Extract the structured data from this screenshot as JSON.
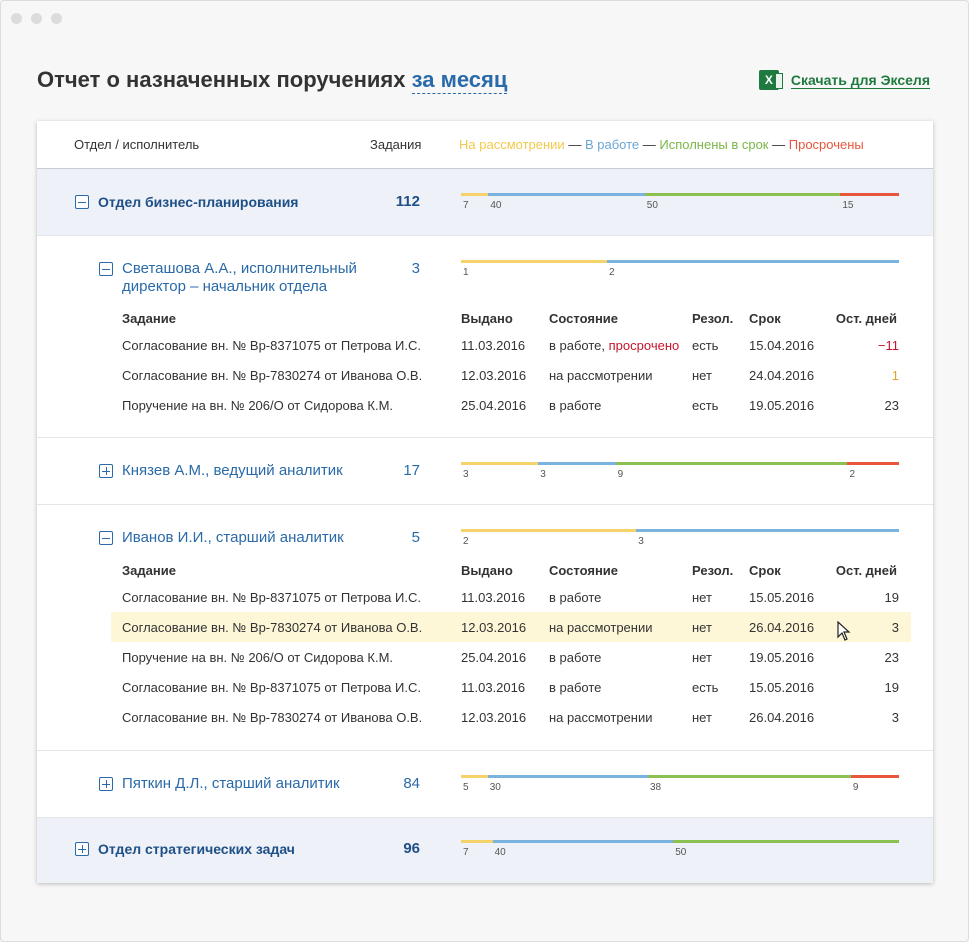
{
  "title": "Отчет о назначенных поручениях",
  "period": "за месяц",
  "download_label": "Скачать для Экселя",
  "columns": {
    "dept": "Отдел / исполнитель",
    "tasks": "Задания"
  },
  "legend": [
    {
      "label": "На рассмотрении",
      "color": "#f5d36a"
    },
    {
      "label": "В работе",
      "color": "#7ab3dd"
    },
    {
      "label": "Исполнены в срок",
      "color": "#8cc152"
    },
    {
      "label": "Просрочены",
      "color": "#e8573c"
    }
  ],
  "legend_sep": "—",
  "task_headers": [
    "Задание",
    "Выдано",
    "Состояние",
    "Резол.",
    "Срок",
    "Ост. дней"
  ],
  "departments": [
    {
      "name": "Отдел бизнес-планирования",
      "count": "112",
      "bar": [
        7,
        40,
        50,
        15
      ]
    },
    {
      "name": "Отдел стратегических задач",
      "count": "96",
      "bar": [
        7,
        40,
        50
      ]
    }
  ],
  "people": [
    {
      "name": "Светашова А.А., исполнительный директор – начальник отдела",
      "count": "3",
      "bar": [
        1,
        2
      ],
      "tasks": [
        {
          "task": "Согласование вн. № Вр-8371075 от Петрова И.С.",
          "issued": "11.03.2016",
          "state": "в работе, ",
          "state_alert": "просрочено",
          "res": "есть",
          "due": "15.04.2016",
          "left": "−11"
        },
        {
          "task": "Согласование вн. № Вр-7830274 от Иванова О.В.",
          "issued": "12.03.2016",
          "state": "на рассмотрении",
          "state_alert": "",
          "res": "нет",
          "due": "24.04.2016",
          "left": "1"
        },
        {
          "task": "Поручение на вн. № 206/О от Сидорова К.М.",
          "issued": "25.04.2016",
          "state": "в работе",
          "state_alert": "",
          "res": "есть",
          "due": "19.05.2016",
          "left": "23"
        }
      ]
    },
    {
      "name": "Князев А.М., ведущий аналитик",
      "count": "17",
      "bar": [
        3,
        3,
        9,
        2
      ]
    },
    {
      "name": "Иванов И.И., старший аналитик",
      "count": "5",
      "bar": [
        2,
        3
      ],
      "tasks": [
        {
          "task": "Согласование вн. № Вр-8371075 от Петрова И.С.",
          "issued": "11.03.2016",
          "state": "в работе",
          "res": "нет",
          "due": "15.05.2016",
          "left": "19"
        },
        {
          "task": "Согласование вн. № Вр-7830274 от Иванова О.В.",
          "issued": "12.03.2016",
          "state": "на рассмотрении",
          "res": "нет",
          "due": "26.04.2016",
          "left": "3"
        },
        {
          "task": "Поручение на вн. № 206/О от Сидорова К.М.",
          "issued": "25.04.2016",
          "state": "в работе",
          "res": "нет",
          "due": "19.05.2016",
          "left": "23"
        },
        {
          "task": "Согласование вн. № Вр-8371075 от Петрова И.С.",
          "issued": "11.03.2016",
          "state": "в работе",
          "res": "есть",
          "due": "15.05.2016",
          "left": "19"
        },
        {
          "task": "Согласование вн. № Вр-7830274 от Иванова О.В.",
          "issued": "12.03.2016",
          "state": "на рассмотрении",
          "res": "нет",
          "due": "26.04.2016",
          "left": "3"
        }
      ]
    },
    {
      "name": "Пяткин Д.Л., старший аналитик",
      "count": "84",
      "bar": [
        5,
        30,
        38,
        9
      ]
    }
  ]
}
